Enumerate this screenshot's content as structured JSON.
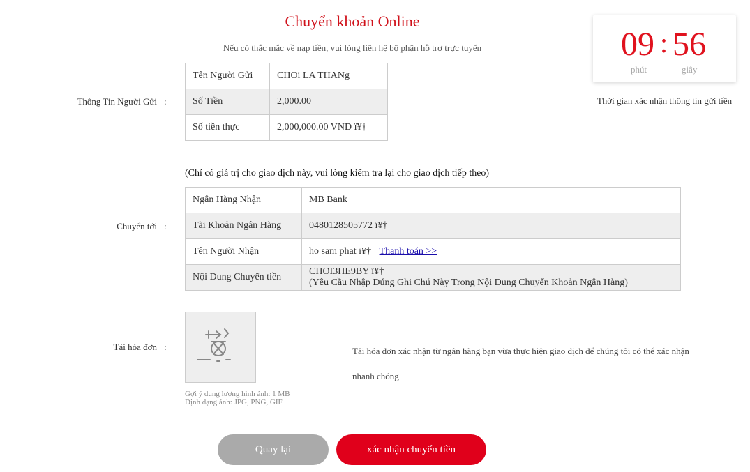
{
  "header": {
    "title": "Chuyển khoản Online",
    "subtitle": "Nếu có thắc mắc về nạp tiền, vui lòng liên hệ bộ phận hỗ trợ trực tuyến"
  },
  "timer": {
    "minutes": "09",
    "separator": ":",
    "seconds": "56",
    "minutes_label": "phút",
    "seconds_label": "giây",
    "note": "Thời gian xác nhận thông tin gửi tiền"
  },
  "sender": {
    "label": "Thông Tin Người Gửi",
    "colon": ":",
    "rows": [
      {
        "key": "Tên Người Gửi",
        "value": "CHOi LA THANg"
      },
      {
        "key": "Số Tiền",
        "value": "2,000.00"
      },
      {
        "key": "Số tiền thực",
        "value": "2,000,000.00 VND ï¥†"
      }
    ]
  },
  "transfer": {
    "notice": "(Chỉ có giá trị cho giao dịch này, vui lòng kiểm tra lại cho giao dịch tiếp theo)",
    "label": "Chuyển tới",
    "colon": ":",
    "rows": [
      {
        "key": "Ngân Hàng Nhận",
        "value": "MB Bank"
      },
      {
        "key": "Tài Khoản Ngân Hàng",
        "value": "0480128505772 ï¥†"
      },
      {
        "key": "Tên Người Nhận",
        "value": "ho sam phat ï¥†",
        "link": "Thanh toán >>"
      },
      {
        "key": "Nội Dung Chuyển tiền",
        "value": "CHOI3HE9BY ï¥†",
        "value2": "(Yêu Cầu Nhập Đúng Ghi Chú Này Trong Nội Dung Chuyển Khoản Ngân Hàng)"
      }
    ]
  },
  "upload": {
    "label": "Tải hóa đơn",
    "colon": ":",
    "icon": "upload-image-icon",
    "hint_size": "Gợi ý dung lượng hình ảnh: 1 MB",
    "hint_format": "Định dạng ảnh: JPG, PNG, GIF",
    "description": "Tải hóa đơn xác nhận từ ngân hàng bạn vừa thực hiện giao dịch để chúng tôi có thể xác nhận nhanh chóng"
  },
  "buttons": {
    "back": "Quay lại",
    "confirm": "xác nhận chuyển tiền"
  },
  "colors": {
    "accent": "#e0001b",
    "timer": "#e0121e",
    "button_gray": "#aaaaaa",
    "link": "#1a0dab"
  }
}
